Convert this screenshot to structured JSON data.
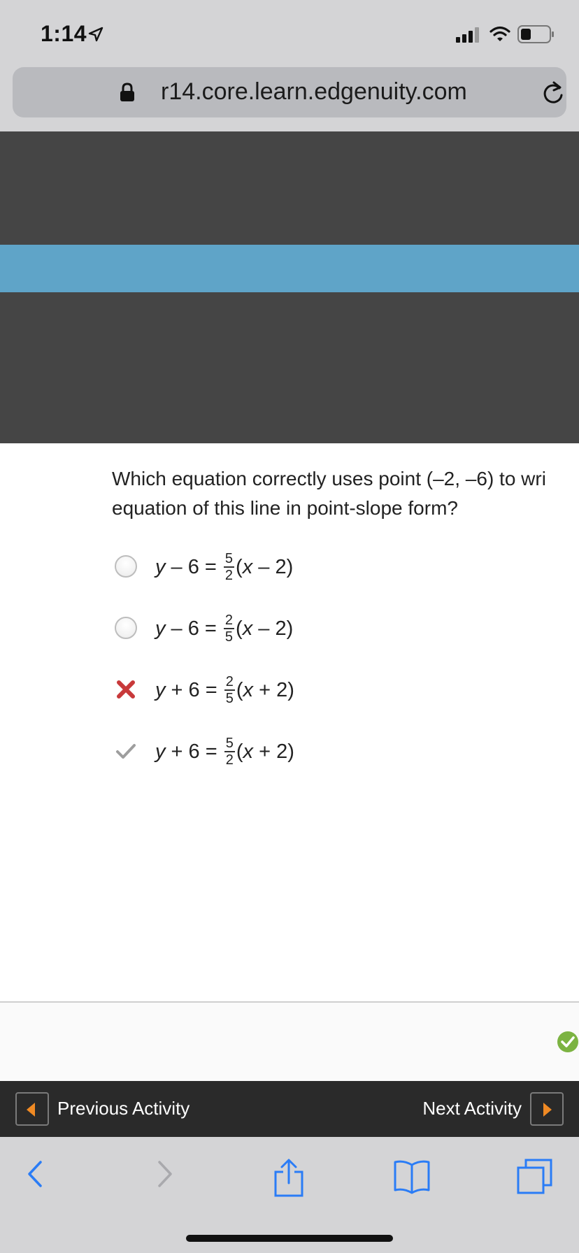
{
  "status_bar": {
    "time": "1:14",
    "icons": [
      "location-arrow-icon",
      "cellular-signal-icon",
      "wifi-icon",
      "battery-icon"
    ]
  },
  "browser": {
    "url": "r14.core.learn.edgenuity.com",
    "icons": [
      "lock-icon",
      "reload-icon"
    ]
  },
  "colors": {
    "header_dark": "#454545",
    "accent_blue": "#5fa4c8",
    "nav_bar": "#2a2a2a",
    "nav_arrow": "#f08a24",
    "incorrect_mark": "#c8393a",
    "correct_mark": "#7cb342"
  },
  "question": {
    "line1": "Which equation correctly uses point (–2, –6) to wri",
    "line2": "equation of this line in point-slope form?"
  },
  "options": [
    {
      "state": "unselected",
      "y": "y",
      "sign": " – 6 = ",
      "num": "5",
      "den": "2",
      "x": "x",
      "tail": " – 2)"
    },
    {
      "state": "unselected",
      "y": "y",
      "sign": " – 6 = ",
      "num": "2",
      "den": "5",
      "x": "x",
      "tail": " – 2)"
    },
    {
      "state": "incorrect",
      "y": "y",
      "sign": " + 6 = ",
      "num": "2",
      "den": "5",
      "x": "x",
      "tail": " + 2)"
    },
    {
      "state": "correct",
      "y": "y",
      "sign": " + 6 = ",
      "num": "5",
      "den": "2",
      "x": "x",
      "tail": " + 2)"
    }
  ],
  "nav": {
    "previous_label": "Previous Activity",
    "next_label": "Next Activity"
  },
  "toolbar": {
    "icons": [
      "back-icon",
      "forward-icon",
      "share-icon",
      "bookmarks-icon",
      "tabs-icon"
    ]
  }
}
